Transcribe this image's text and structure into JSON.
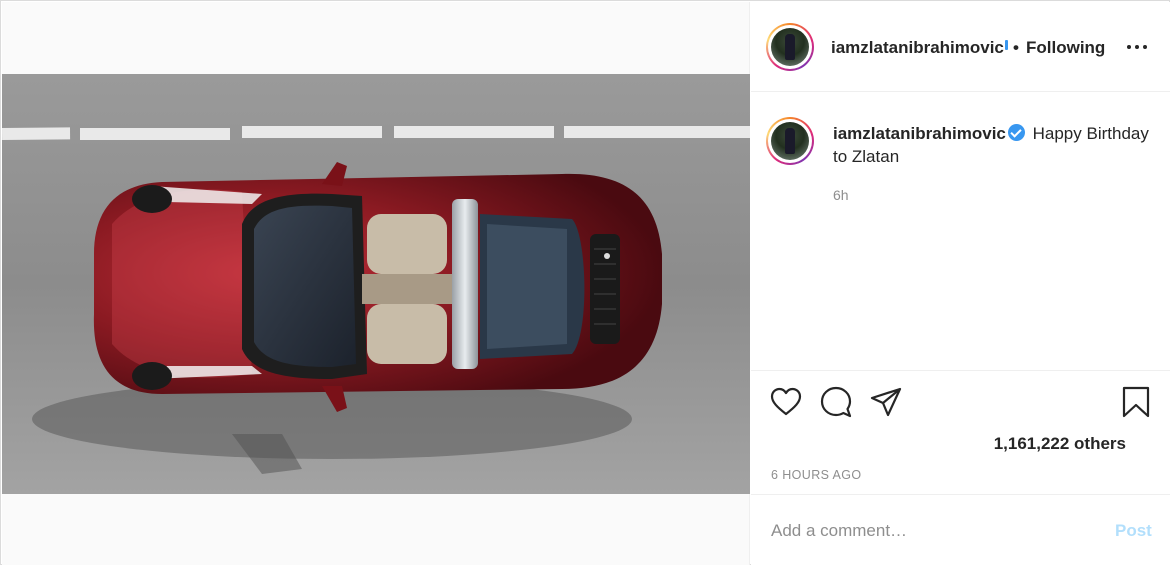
{
  "post": {
    "image_alt": "Red convertible sports car seen from above on a road",
    "author": {
      "username": "iamzlatanibrahimovic",
      "verified": true,
      "follow_status": "Following"
    },
    "caption": {
      "text": "Happy Birthday to Zlatan",
      "relative_time": "6h"
    },
    "likes_text": "1,161,222 others",
    "timestamp": "6 HOURS AGO"
  },
  "comment": {
    "placeholder": "Add a comment…",
    "post_label": "Post"
  },
  "colors": {
    "accent": "#3897f0",
    "post_disabled": "#b2dffc",
    "text": "#262626",
    "muted": "#8e8e8e",
    "car_red": "#8b1a22"
  },
  "icons": {
    "like": "heart-icon",
    "comment": "comment-icon",
    "share": "paper-plane-icon",
    "save": "bookmark-icon",
    "more": "more-options-icon"
  }
}
